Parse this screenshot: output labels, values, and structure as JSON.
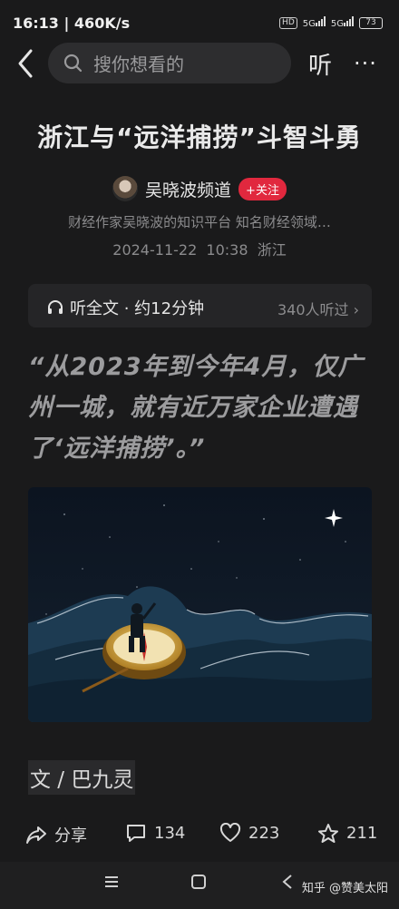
{
  "status_bar": {
    "time": "16:13",
    "speed": "460K/s",
    "hd": "HD",
    "net1": "5G",
    "net2": "5G",
    "battery": "73"
  },
  "nav": {
    "search_placeholder": "搜你想看的",
    "listen_label": "听",
    "more_label": "···"
  },
  "article": {
    "title": "浙江与“远洋捕捞”斗智斗勇",
    "author": "吴晓波频道",
    "follow_label": "+关注",
    "author_desc": "财经作家吴晓波的知识平台 知名财经领域…",
    "date": "2024-11-22",
    "time": "10:38",
    "location": "浙江",
    "listen_bar": {
      "label": "听全文 · 约12分钟",
      "listeners": "340人听过"
    },
    "quote": "“从2023年到今年4月，仅广州一城，就有近万家企业遭遇了‘远洋捕捞’。”",
    "byline": "文 / 巴九灵"
  },
  "actions": {
    "share_label": "分享",
    "comments_count": "134",
    "likes_count": "223",
    "favorites_count": "211"
  },
  "watermark": "知乎 @赞美太阳",
  "colors": {
    "background": "#1a1a1b",
    "follow_red": "#e1283e",
    "muted_text": "#8b8b8d"
  }
}
